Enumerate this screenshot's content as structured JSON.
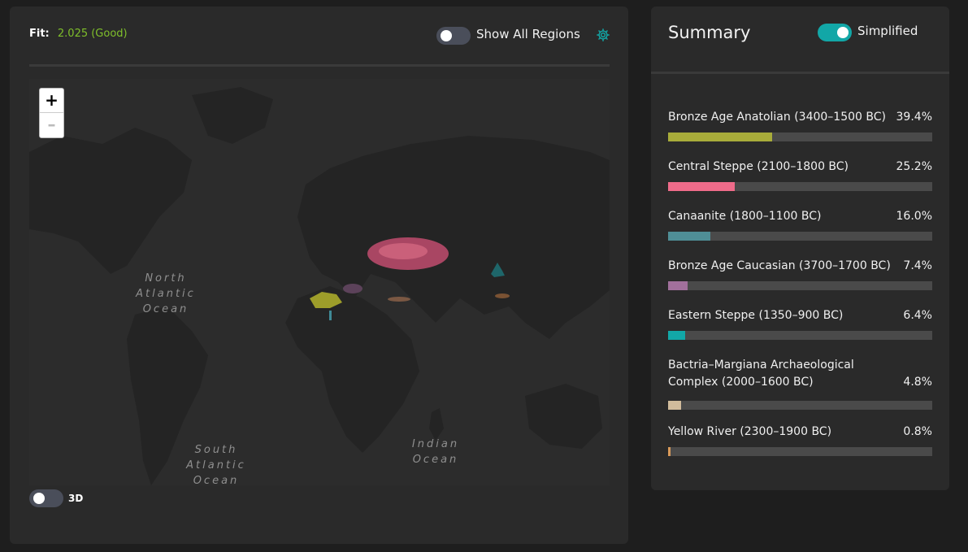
{
  "fit": {
    "label": "Fit:",
    "value": "2.025 (Good)"
  },
  "map_controls": {
    "show_all_regions": {
      "label": "Show All Regions",
      "on": false
    },
    "zoom_in": "+",
    "zoom_out": "–",
    "three_d": {
      "label": "3D",
      "on": false
    }
  },
  "map_labels": {
    "north_atlantic": [
      "North",
      "Atlantic",
      "Ocean"
    ],
    "south_atlantic": [
      "South",
      "Atlantic",
      "Ocean"
    ],
    "indian": [
      "Indian",
      "Ocean"
    ]
  },
  "summary": {
    "title": "Summary",
    "simplified": {
      "label": "Simplified",
      "on": true
    },
    "items": [
      {
        "name": "Bronze Age Anatolian (3400–1500 BC)",
        "percent": "39.4%",
        "value": 39.4,
        "color": "#a8ac3a"
      },
      {
        "name": "Central Steppe (2100–1800 BC)",
        "percent": "25.2%",
        "value": 25.2,
        "color": "#ef6b8a"
      },
      {
        "name": "Canaanite (1800–1100 BC)",
        "percent": "16.0%",
        "value": 16.0,
        "color": "#4f8e96"
      },
      {
        "name": "Bronze Age Caucasian (3700–1700 BC)",
        "percent": "7.4%",
        "value": 7.4,
        "color": "#a2709c"
      },
      {
        "name": "Eastern Steppe (1350–900 BC)",
        "percent": "6.4%",
        "value": 6.4,
        "color": "#12a8a8"
      },
      {
        "name": "Bactria–Margiana Archaeological Complex (2000–1600 BC)",
        "percent": "4.8%",
        "value": 4.8,
        "color": "#d1bc9c"
      },
      {
        "name": "Yellow River (2300–1900 BC)",
        "percent": "0.8%",
        "value": 0.8,
        "color": "#d99a5a"
      }
    ]
  }
}
